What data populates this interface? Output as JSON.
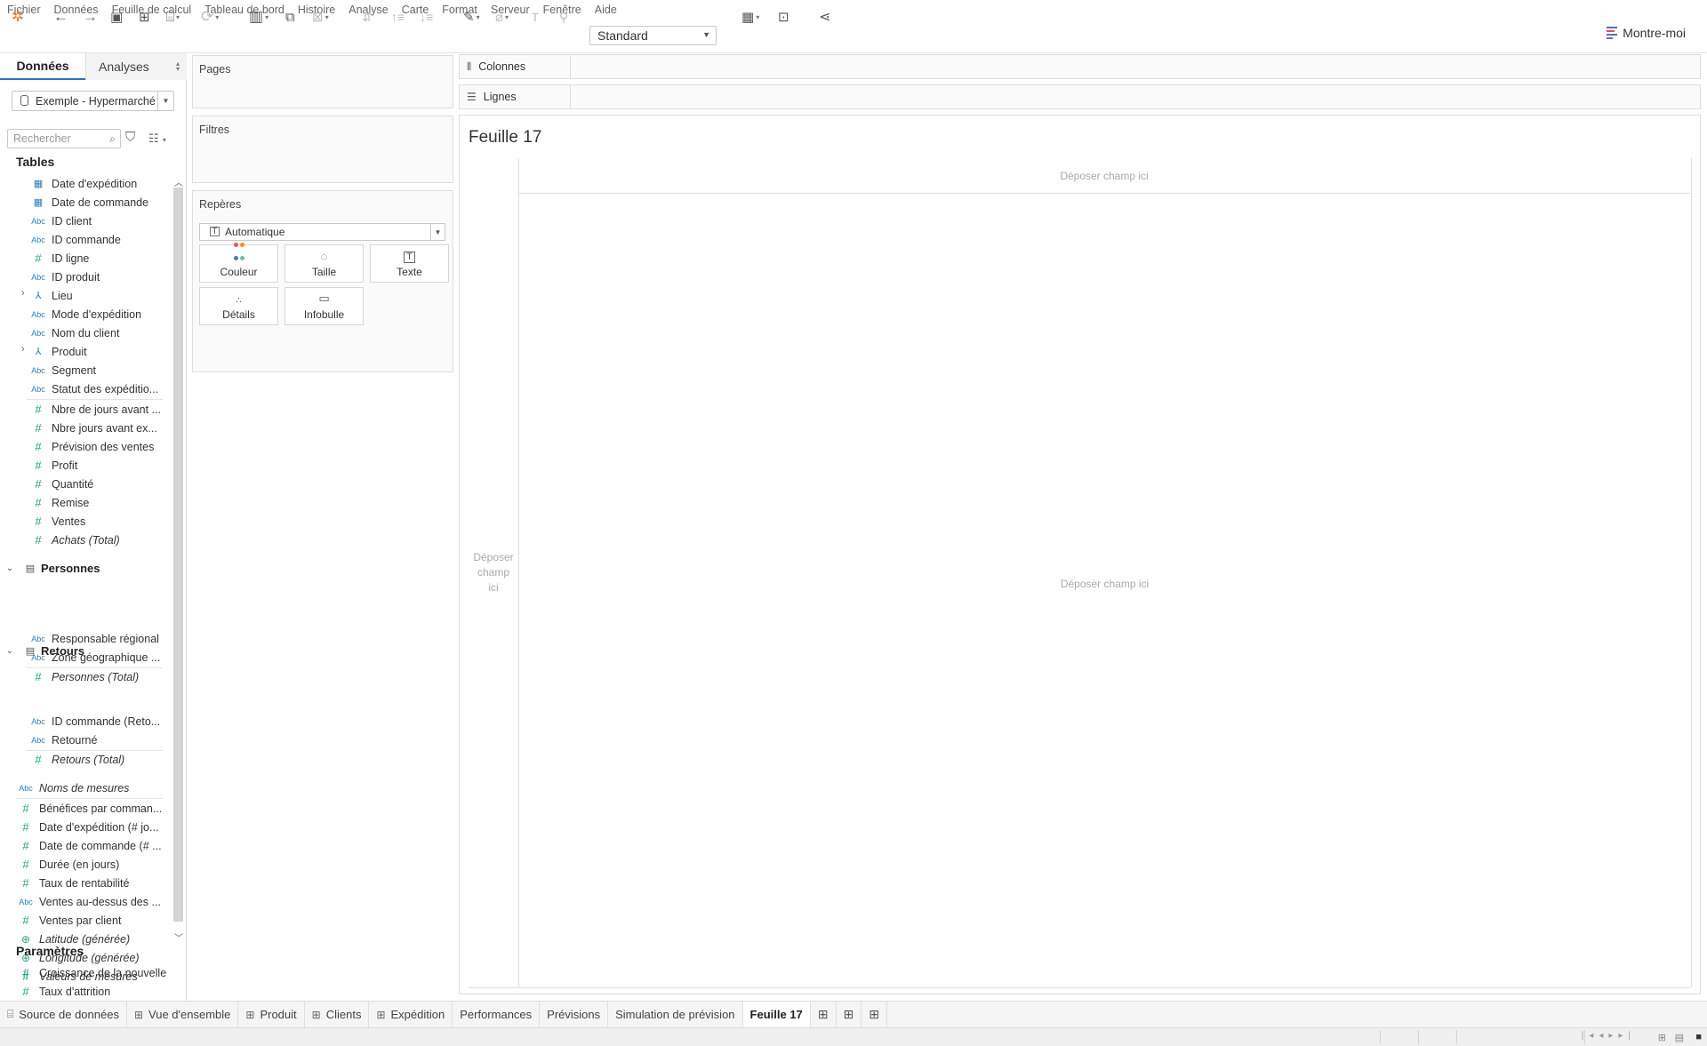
{
  "menu": [
    "Fichier",
    "Données",
    "Feuille de calcul",
    "Tableau de bord",
    "Histoire",
    "Analyse",
    "Carte",
    "Format",
    "Serveur",
    "Fenêtre",
    "Aide"
  ],
  "toolbar": {
    "fit_select": "Standard",
    "show_me": "Montre-moi"
  },
  "left": {
    "tab_data": "Données",
    "tab_analytics": "Analyses",
    "datasource": "Exemple - Hypermarché",
    "search_placeholder": "Rechercher",
    "tables_title": "Tables",
    "orders_fields": [
      {
        "type": "cal",
        "label": "Date d'expédition"
      },
      {
        "type": "cal",
        "label": "Date de commande"
      },
      {
        "type": "abc",
        "label": "ID client"
      },
      {
        "type": "abc",
        "label": "ID commande"
      },
      {
        "type": "num",
        "label": "ID ligne"
      },
      {
        "type": "abc",
        "label": "ID produit"
      },
      {
        "type": "hier",
        "label": "Lieu"
      },
      {
        "type": "abc",
        "label": "Mode d'expédition"
      },
      {
        "type": "abc",
        "label": "Nom du client"
      },
      {
        "type": "hier",
        "label": "Produit"
      },
      {
        "type": "abc",
        "label": "Segment"
      },
      {
        "type": "abc",
        "label": "Statut des expéditio..."
      },
      {
        "type": "num",
        "label": "Nbre de jours avant ..."
      },
      {
        "type": "num",
        "label": "Nbre jours avant ex..."
      },
      {
        "type": "num",
        "label": "Prévision des ventes"
      },
      {
        "type": "num",
        "label": "Profit"
      },
      {
        "type": "num",
        "label": "Quantité"
      },
      {
        "type": "num",
        "label": "Remise"
      },
      {
        "type": "num",
        "label": "Ventes"
      },
      {
        "type": "num",
        "label": "Achats (Total)"
      }
    ],
    "people_title": "Personnes",
    "people_fields": [
      {
        "type": "abc",
        "label": "Responsable régional"
      },
      {
        "type": "abc",
        "label": "Zone géographique ..."
      },
      {
        "type": "num",
        "label": "Personnes (Total)"
      }
    ],
    "returns_title": "Retours",
    "returns_fields": [
      {
        "type": "abc",
        "label": "ID commande (Reto..."
      },
      {
        "type": "abc",
        "label": "Retourné"
      },
      {
        "type": "num",
        "label": "Retours (Total)"
      }
    ],
    "loose_fields": [
      {
        "type": "abc",
        "label": "Noms de mesures"
      },
      {
        "type": "num",
        "label": "Bénéfices par comman..."
      },
      {
        "type": "num",
        "label": "Date d'expédition (# jo..."
      },
      {
        "type": "num",
        "label": "Date de commande (# ..."
      },
      {
        "type": "num",
        "label": "Durée (en jours)"
      },
      {
        "type": "num",
        "label": "Taux de rentabilité"
      },
      {
        "type": "abc",
        "label": "Ventes au-dessus des ..."
      },
      {
        "type": "num",
        "label": "Ventes par client"
      },
      {
        "type": "geo",
        "label": "Latitude (générée)"
      },
      {
        "type": "geo",
        "label": "Longitude (générée)"
      },
      {
        "type": "num",
        "label": "Valeurs de mesures"
      }
    ],
    "params_title": "Paramètres",
    "params": [
      {
        "type": "num",
        "label": "Croissance de la nouvelle ..."
      },
      {
        "type": "num",
        "label": "Taux d'attrition"
      }
    ]
  },
  "cards": {
    "pages": "Pages",
    "filters": "Filtres",
    "marks": "Repères",
    "marks_type": "Automatique",
    "color": "Couleur",
    "size": "Taille",
    "text": "Texte",
    "detail": "Détails",
    "tooltip": "Infobulle"
  },
  "shelves": {
    "columns": "Colonnes",
    "rows": "Lignes"
  },
  "view": {
    "title": "Feuille 17",
    "drop_top": "Déposer champ ici",
    "drop_left": "Déposer champ ici",
    "drop_main": "Déposer champ ici"
  },
  "sheet_tabs": {
    "datasource": "Source de données",
    "tabs": [
      "Vue d'ensemble",
      "Produit",
      "Clients",
      "Expédition"
    ],
    "stories": [
      "Performances",
      "Prévisions",
      "Simulation de prévision"
    ],
    "active": "Feuille 17"
  }
}
